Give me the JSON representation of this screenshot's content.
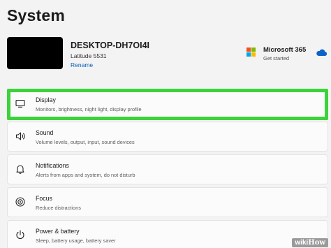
{
  "header": {
    "title": "System"
  },
  "device": {
    "name": "DESKTOP-DH7OI4I",
    "model": "Latitude 5531",
    "rename_label": "Rename"
  },
  "microsoft365": {
    "title": "Microsoft 365",
    "subtitle": "Get started",
    "logo_colors": [
      "#f25022",
      "#7fba00",
      "#00a4ef",
      "#ffb900"
    ],
    "cloud_icon": "onedrive-cloud-icon"
  },
  "settings": [
    {
      "title": "Display",
      "desc": "Monitors, brightness, night light, display profile",
      "icon": "monitor-icon"
    },
    {
      "title": "Sound",
      "desc": "Volume levels, output, input, sound devices",
      "icon": "speaker-icon"
    },
    {
      "title": "Notifications",
      "desc": "Alerts from apps and system, do not disturb",
      "icon": "bell-icon"
    },
    {
      "title": "Focus",
      "desc": "Reduce distractions",
      "icon": "focus-icon"
    },
    {
      "title": "Power & battery",
      "desc": "Sleep, battery usage, battery saver",
      "icon": "power-icon"
    }
  ],
  "highlight_color": "#3cd33a",
  "watermark": {
    "part1": "wiki",
    "part2": "How"
  }
}
